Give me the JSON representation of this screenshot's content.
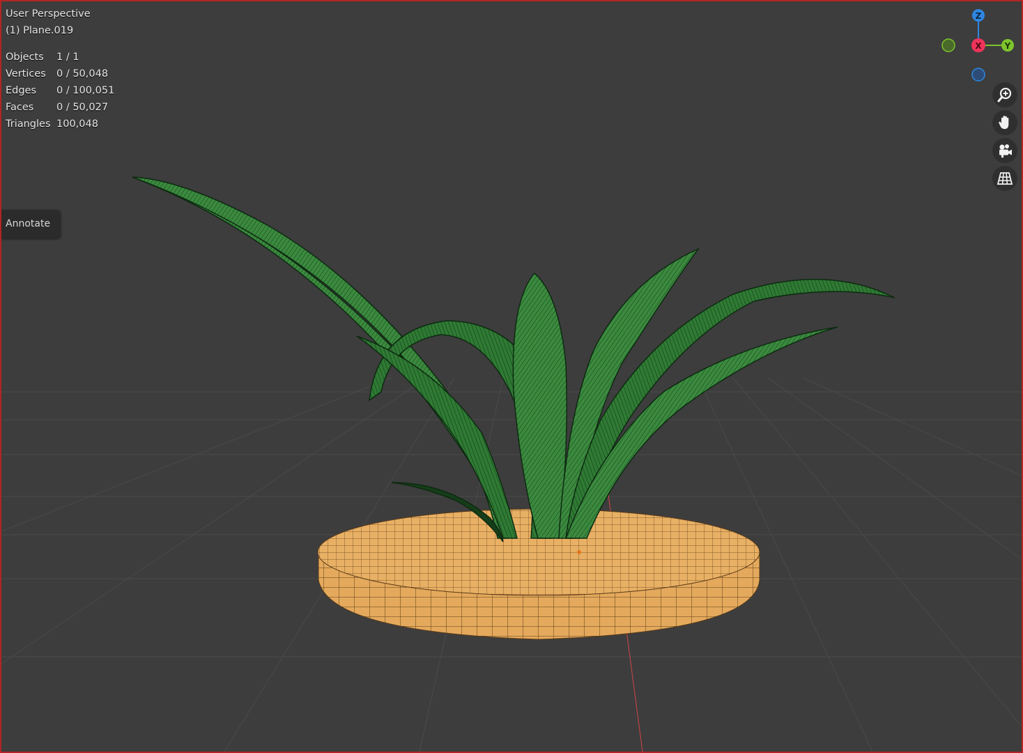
{
  "viewport": {
    "title": "User Perspective",
    "object_name": "(1) Plane.019"
  },
  "stats": [
    {
      "label": "Objects",
      "value": "1 / 1"
    },
    {
      "label": "Vertices",
      "value": "0 / 50,048"
    },
    {
      "label": "Edges",
      "value": "0 / 100,051"
    },
    {
      "label": "Faces",
      "value": "0 / 50,027"
    },
    {
      "label": "Triangles",
      "value": "100,048"
    }
  ],
  "toolbar": {
    "annotate_label": "Annotate"
  },
  "gizmo": {
    "z_label": "Z",
    "x_label": "X",
    "y_label": "Y",
    "colors": {
      "x": "#f0335a",
      "y": "#7ec42c",
      "z": "#2e86e0"
    }
  },
  "navigation": [
    {
      "name": "zoom-icon"
    },
    {
      "name": "hand-pan-icon"
    },
    {
      "name": "camera-icon"
    },
    {
      "name": "grid-ortho-icon"
    }
  ],
  "colors": {
    "background": "#3d3d3d",
    "leaf": "#2e7d32",
    "pot": "#e0a050",
    "border": "#b32424"
  }
}
